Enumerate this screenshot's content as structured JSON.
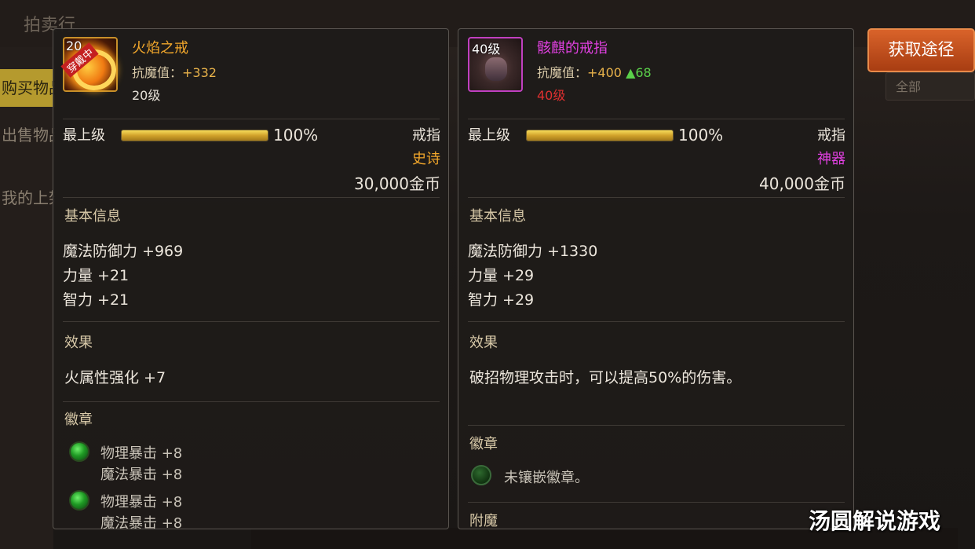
{
  "background": {
    "title": "拍卖行",
    "tabs": [
      "购买物品",
      "出售物品",
      "我的上架"
    ],
    "filter": "全部"
  },
  "left_item": {
    "level_badge": "20",
    "equipped_badge": "穿戴中",
    "name": "火焰之戒",
    "stat_label": "抗魔值：",
    "stat_value": "+332",
    "level_text": "20级",
    "grade_label": "最上级",
    "grade_pct": "100%",
    "grade_fill": 1.0,
    "slot_type": "戒指",
    "rarity": "史诗",
    "price": "30,000金币",
    "basic_title": "基本信息",
    "attrs": [
      "魔法防御力 +969",
      "力量 +21",
      "智力 +21"
    ],
    "effect_title": "效果",
    "effect": "火属性强化 +7",
    "emblem_title": "徽章",
    "emblems": [
      {
        "line1": "物理暴击 +8",
        "line2": "魔法暴击 +8"
      },
      {
        "line1": "物理暴击 +8",
        "line2": "魔法暴击 +8"
      }
    ]
  },
  "right_item": {
    "level_badge": "40级",
    "name": "骸麒的戒指",
    "stat_label": "抗魔值：",
    "stat_value": "+400",
    "stat_delta": "▲68",
    "level_text": "40级",
    "grade_label": "最上级",
    "grade_pct": "100%",
    "grade_fill": 1.0,
    "slot_type": "戒指",
    "rarity": "神器",
    "price": "40,000金币",
    "basic_title": "基本信息",
    "attrs": [
      "魔法防御力 +1330",
      "力量 +29",
      "智力 +29"
    ],
    "effect_title": "效果",
    "effect": "破招物理攻击时，可以提高50%的伤害。",
    "emblem_title": "徽章",
    "emblem_empty": "未镶嵌徽章。",
    "enchant_title": "附魔"
  },
  "acquire_button": "获取途径",
  "watermark": "汤圆解说游戏",
  "colors": {
    "epic": "#f2a72b",
    "artifact": "#e040e0",
    "button": "#c4521e",
    "bar": "#e2b434",
    "positive": "#5ad04a",
    "level_warning": "#e03030"
  }
}
